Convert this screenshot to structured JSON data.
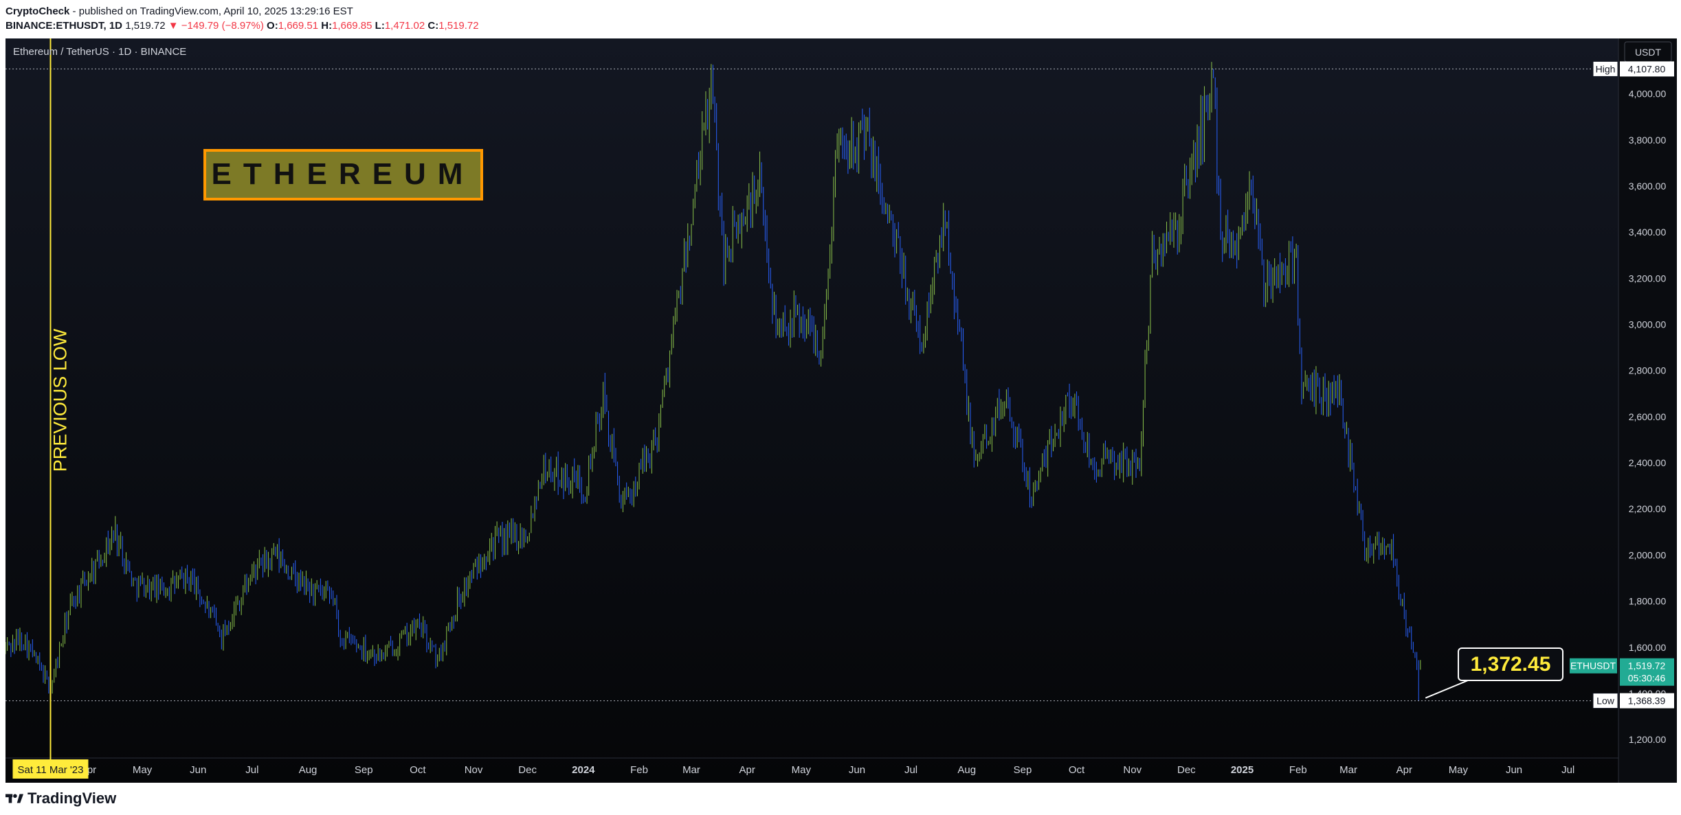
{
  "header": {
    "author": "CryptoCheck",
    "published": "- published on TradingView.com, April 10, 2025 13:29:16 EST",
    "symbol": "BINANCE:ETHUSDT, 1D",
    "last": "1,519.72",
    "change": "▼ −149.79 (−8.97%)",
    "o_label": "O:",
    "o_val": "1,669.51",
    "h_label": "H:",
    "h_val": "1,669.85",
    "l_label": "L:",
    "l_val": "1,471.02",
    "c_label": "C:",
    "c_val": "1,519.72"
  },
  "legend": "Ethereum / TetherUS · 1D · BINANCE",
  "currency": "USDT",
  "banner_text": "ETHEREUM",
  "previous_low_label": "PREVIOUS LOW",
  "previous_low_date": "Sat 11 Mar '23",
  "callout_value": "1,372.45",
  "high_label": "High",
  "high_value": "4,107.80",
  "low_label": "Low",
  "low_value": "1,368.39",
  "last_symbol": "ETHUSDT",
  "last_price": "1,519.72",
  "countdown": "05:30:46",
  "footer_brand": "TradingView",
  "colors": {
    "up": "#8bc34a",
    "down": "#2962ff",
    "highlight": "#ffeb3b",
    "banner_fill": "#7d7a26",
    "banner_border": "#ff9800",
    "last_price_bg": "#22ab94"
  },
  "chart_data": {
    "type": "candlestick",
    "symbol": "ETHUSDT",
    "interval": "1D",
    "y_ticks": [
      "1,200.00",
      "1,400.00",
      "1,600.00",
      "1,800.00",
      "2,000.00",
      "2,200.00",
      "2,400.00",
      "2,600.00",
      "2,800.00",
      "3,000.00",
      "3,200.00",
      "3,400.00",
      "3,600.00",
      "3,800.00",
      "4,000.00"
    ],
    "ylim": [
      1120,
      4240
    ],
    "x_ticks": [
      "Apr",
      "May",
      "Jun",
      "Jul",
      "Aug",
      "Sep",
      "Oct",
      "Nov",
      "Dec",
      "2024",
      "Feb",
      "Mar",
      "Apr",
      "May",
      "Jun",
      "Jul",
      "Aug",
      "Sep",
      "Oct",
      "Nov",
      "Dec",
      "2025",
      "Feb",
      "Mar",
      "Apr",
      "May",
      "Jun",
      "Jul"
    ],
    "x_tick_dates": [
      "2023-04-01",
      "2023-05-01",
      "2023-06-01",
      "2023-07-01",
      "2023-08-01",
      "2023-09-01",
      "2023-10-01",
      "2023-11-01",
      "2023-12-01",
      "2024-01-01",
      "2024-02-01",
      "2024-03-01",
      "2024-04-01",
      "2024-05-01",
      "2024-06-01",
      "2024-07-01",
      "2024-08-01",
      "2024-09-01",
      "2024-10-01",
      "2024-11-01",
      "2024-12-01",
      "2025-01-01",
      "2025-02-01",
      "2025-03-01",
      "2025-04-01",
      "2025-05-01",
      "2025-06-01",
      "2025-07-01"
    ],
    "x_range": [
      "2023-02-14",
      "2025-07-29"
    ],
    "price_path": [
      [
        "2023-02-14",
        1600
      ],
      [
        "2023-02-24",
        1640
      ],
      [
        "2023-03-11",
        1420
      ],
      [
        "2023-03-22",
        1780
      ],
      [
        "2023-04-16",
        2100
      ],
      [
        "2023-04-26",
        1880
      ],
      [
        "2023-05-10",
        1850
      ],
      [
        "2023-05-28",
        1900
      ],
      [
        "2023-06-14",
        1650
      ],
      [
        "2023-07-01",
        1920
      ],
      [
        "2023-07-14",
        2000
      ],
      [
        "2023-07-28",
        1870
      ],
      [
        "2023-08-16",
        1800
      ],
      [
        "2023-08-18",
        1650
      ],
      [
        "2023-09-11",
        1560
      ],
      [
        "2023-10-02",
        1700
      ],
      [
        "2023-10-12",
        1540
      ],
      [
        "2023-10-23",
        1800
      ],
      [
        "2023-11-10",
        2050
      ],
      [
        "2023-12-01",
        2100
      ],
      [
        "2023-12-09",
        2380
      ],
      [
        "2024-01-02",
        2300
      ],
      [
        "2024-01-12",
        2680
      ],
      [
        "2024-01-23",
        2200
      ],
      [
        "2024-02-10",
        2500
      ],
      [
        "2024-02-29",
        3400
      ],
      [
        "2024-03-12",
        4040
      ],
      [
        "2024-03-19",
        3300
      ],
      [
        "2024-04-08",
        3600
      ],
      [
        "2024-04-17",
        2990
      ],
      [
        "2024-04-30",
        3040
      ],
      [
        "2024-05-13",
        2900
      ],
      [
        "2024-05-21",
        3800
      ],
      [
        "2024-06-06",
        3820
      ],
      [
        "2024-06-24",
        3300
      ],
      [
        "2024-07-07",
        2900
      ],
      [
        "2024-07-20",
        3500
      ],
      [
        "2024-08-05",
        2400
      ],
      [
        "2024-08-23",
        2700
      ],
      [
        "2024-09-06",
        2250
      ],
      [
        "2024-09-27",
        2700
      ],
      [
        "2024-10-10",
        2400
      ],
      [
        "2024-11-05",
        2400
      ],
      [
        "2024-11-12",
        3300
      ],
      [
        "2024-11-25",
        3400
      ],
      [
        "2024-12-16",
        4050
      ],
      [
        "2024-12-20",
        3400
      ],
      [
        "2024-12-30",
        3350
      ],
      [
        "2025-01-06",
        3650
      ],
      [
        "2025-01-13",
        3150
      ],
      [
        "2025-01-31",
        3300
      ],
      [
        "2025-02-03",
        2700
      ],
      [
        "2025-02-24",
        2700
      ],
      [
        "2025-03-10",
        2050
      ],
      [
        "2025-03-25",
        2050
      ],
      [
        "2025-03-30",
        1800
      ],
      [
        "2025-04-07",
        1550
      ],
      [
        "2025-04-09",
        1480
      ],
      [
        "2025-04-10",
        1519.72
      ]
    ],
    "high": {
      "date": "2024-12-16",
      "value": 4107.8
    },
    "low": {
      "date": "2025-04-09",
      "value": 1368.39
    },
    "previous_low": {
      "date": "2023-03-11"
    },
    "callout": {
      "value": 1372.45
    },
    "last_price": 1519.72,
    "grid": false
  }
}
